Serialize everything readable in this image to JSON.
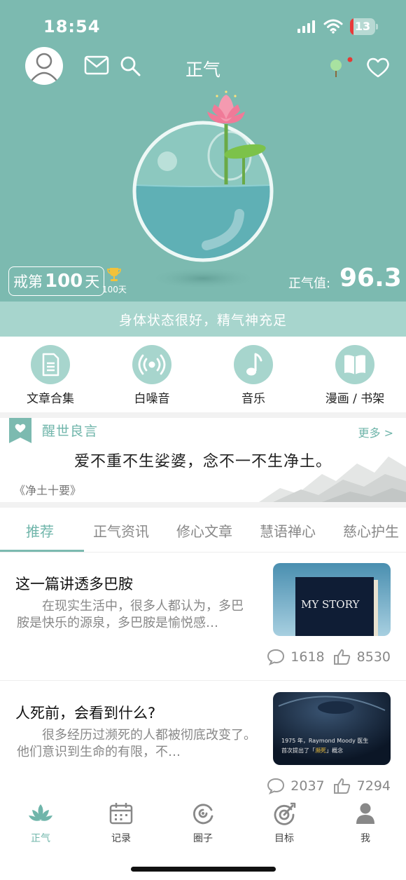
{
  "status_bar": {
    "time": "18:54",
    "battery": "13",
    "battery_level": 0.13
  },
  "header": {
    "title": "正气"
  },
  "hero": {
    "days_prefix": "戒第",
    "days_count": "100",
    "days_suffix": "天",
    "trophy_label": "100天",
    "score_label": "正气值:",
    "score_value": "96.3"
  },
  "status_message": "身体状态很好，精气神充足",
  "shortcuts": [
    {
      "label": "文章合集",
      "icon": "document-icon"
    },
    {
      "label": "白噪音",
      "icon": "broadcast-icon"
    },
    {
      "label": "音乐",
      "icon": "music-note-icon"
    },
    {
      "label": "漫画 / 书架",
      "icon": "book-icon"
    }
  ],
  "quote": {
    "title": "醒世良言",
    "more": "更多 >",
    "text": "爱不重不生娑婆，念不一不生净土。",
    "source": "《净土十要》"
  },
  "tabs": [
    "推荐",
    "正气资讯",
    "修心文章",
    "慧语禅心",
    "慈心护生"
  ],
  "articles": [
    {
      "title": "这一篇讲透多巴胺",
      "summary": "　　在现实生活中，很多人都认为，多巴胺是快乐的源泉，多巴胺是愉悦感…",
      "thumb_text": "MY STORY",
      "comments": "1618",
      "likes": "8530"
    },
    {
      "title": "人死前，会看到什么?",
      "summary": "　　很多经历过濒死的人都被彻底改变了。　　他们意识到生命的有限，不…",
      "thumb_line1": "1975 年，Raymond Moody 医生",
      "thumb_line2_pre": "首次提出了「",
      "thumb_line2_em": "濒死",
      "thumb_line2_post": "」概念",
      "comments": "2037",
      "likes": "7294"
    }
  ],
  "bottom_nav": [
    {
      "label": "正气",
      "icon": "lotus-icon"
    },
    {
      "label": "记录",
      "icon": "calendar-icon"
    },
    {
      "label": "圈子",
      "icon": "circle-icon"
    },
    {
      "label": "目标",
      "icon": "target-icon"
    },
    {
      "label": "我",
      "icon": "person-icon"
    }
  ],
  "colors": {
    "primary": "#7cbab0",
    "light": "#a7d5cd",
    "accent_text": "#6fb5aa",
    "battery_low": "#e83a3a",
    "lotus": "#f07a98"
  }
}
